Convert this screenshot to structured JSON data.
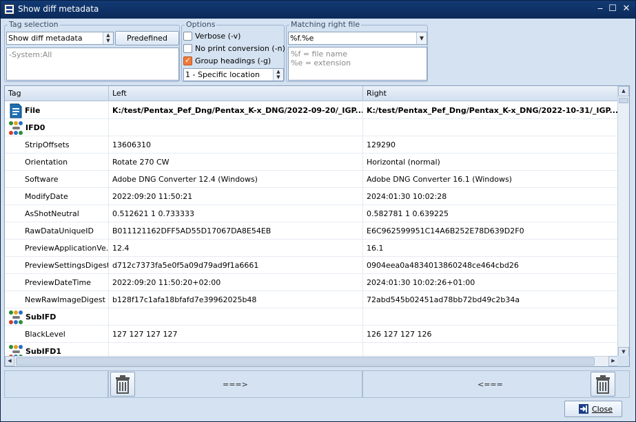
{
  "window": {
    "title": "Show diff metadata"
  },
  "tag_selection": {
    "legend": "Tag selection",
    "combo_value": "Show diff metadata",
    "predefined_label": "Predefined",
    "memo_text": "-System:All"
  },
  "options": {
    "legend": "Options",
    "verbose_label": "Verbose (-v)",
    "verbose_checked": false,
    "noprint_label": "No print conversion (-n)",
    "noprint_checked": false,
    "group_headings_label": "Group headings (-g)",
    "group_headings_checked": true,
    "location_value": "1 - Specific location"
  },
  "matching": {
    "legend": "Matching right file",
    "pattern_value": "%f.%e",
    "hint_1": "%f = file name",
    "hint_2": "%e = extension"
  },
  "grid": {
    "columns": {
      "tag": "Tag",
      "left": "Left",
      "right": "Right"
    },
    "rows": [
      {
        "type": "file",
        "tag": "File",
        "left": "K:/test/Pentax_Pef_Dng/Pentax_K-x_DNG/2022-09-20/_IGP...",
        "right": "K:/test/Pentax_Pef_Dng/Pentax_K-x_DNG/2022-10-31/_IGP..."
      },
      {
        "type": "group",
        "tag": "IFD0",
        "left": "",
        "right": ""
      },
      {
        "type": "data",
        "tag": "StripOffsets",
        "left": "13606310",
        "right": "129290"
      },
      {
        "type": "data",
        "tag": "Orientation",
        "left": "Rotate 270 CW",
        "right": "Horizontal (normal)"
      },
      {
        "type": "data",
        "tag": "Software",
        "left": "Adobe DNG Converter 12.4 (Windows)",
        "right": "Adobe DNG Converter 16.1 (Windows)"
      },
      {
        "type": "data",
        "tag": "ModifyDate",
        "left": "2022:09:20 11:50:21",
        "right": "2024:01:30 10:02:28"
      },
      {
        "type": "data",
        "tag": "AsShotNeutral",
        "left": "0.512621 1 0.733333",
        "right": "0.582781 1 0.639225"
      },
      {
        "type": "data",
        "tag": "RawDataUniqueID",
        "left": "B011121162DFF5AD55D17067DA8E54EB",
        "right": "E6C962599951C14A6B252E78D639D2F0"
      },
      {
        "type": "data",
        "tag": "PreviewApplicationVe...",
        "left": "12.4",
        "right": "16.1"
      },
      {
        "type": "data",
        "tag": "PreviewSettingsDigest",
        "left": "d712c7373fa5e0f5a09d79ad9f1a6661",
        "right": "0904eea0a4834013860248ce464cbd26"
      },
      {
        "type": "data",
        "tag": "PreviewDateTime",
        "left": "2022:09:20 11:50:20+02:00",
        "right": "2024:01:30 10:02:26+01:00"
      },
      {
        "type": "data",
        "tag": "NewRawImageDigest",
        "left": "b128f17c1afa18bfafd7e39962025b48",
        "right": "72abd545b02451ad78bb72bd49c2b34a"
      },
      {
        "type": "group",
        "tag": "SubIFD",
        "left": "",
        "right": ""
      },
      {
        "type": "data",
        "tag": "BlackLevel",
        "left": "127 127 127 127",
        "right": "126 127 127 126"
      },
      {
        "type": "group",
        "tag": "SubIFD1",
        "left": "",
        "right": ""
      }
    ]
  },
  "bottom": {
    "copy_right_label": "===>",
    "copy_left_label": "<==="
  },
  "close_label": "Close",
  "colors": {
    "titlebar": "#0b2a59",
    "check_on": "#f07a3a",
    "window_bg": "#d4e2f1"
  }
}
